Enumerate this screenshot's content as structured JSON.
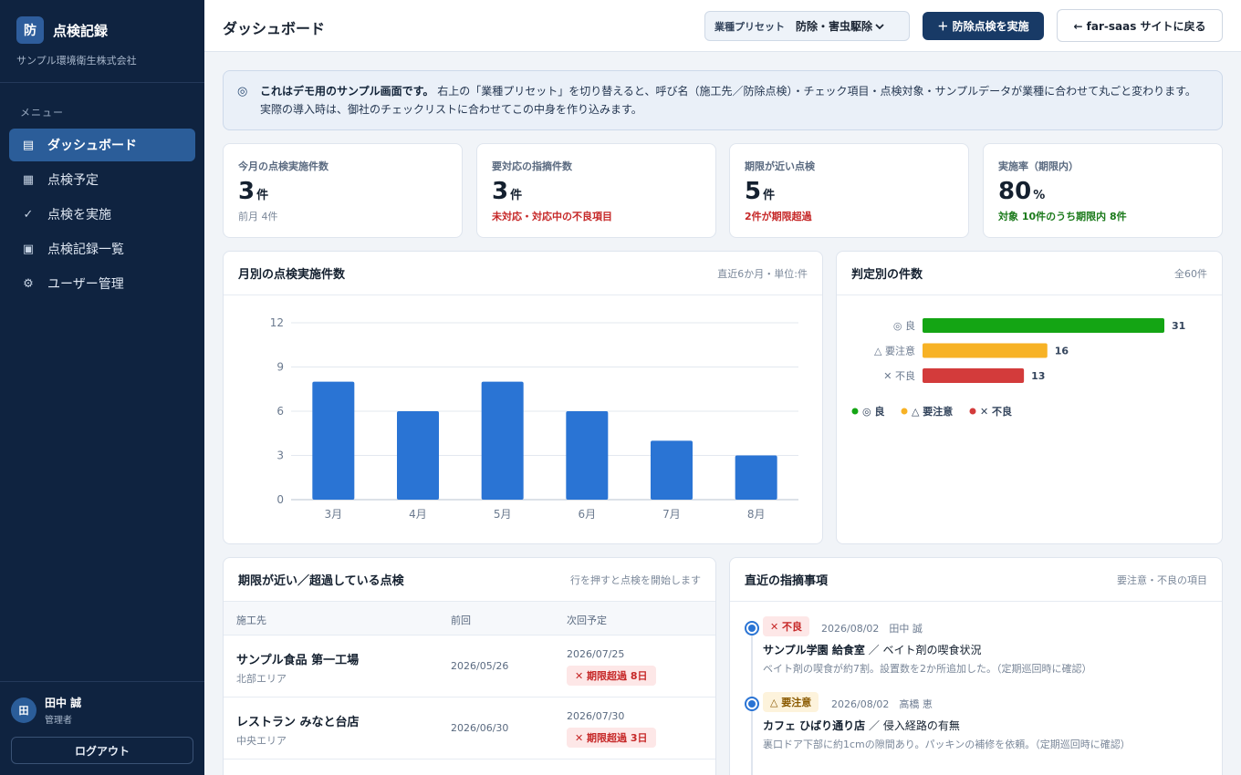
{
  "sidebar": {
    "brand_mark": "防",
    "brand_name": "点検記録",
    "company": "サンプル環境衛生株式会社",
    "menu_title": "メニュー",
    "items": [
      {
        "label": "ダッシュボード",
        "icon": "▤"
      },
      {
        "label": "点検予定",
        "icon": "▦"
      },
      {
        "label": "点検を実施",
        "icon": "✓"
      },
      {
        "label": "点検記録一覧",
        "icon": "▣"
      },
      {
        "label": "ユーザー管理",
        "icon": "⚙"
      }
    ],
    "user": {
      "initial": "田",
      "name": "田中 誠",
      "role": "管理者"
    },
    "logout_label": "ログアウト"
  },
  "header": {
    "title": "ダッシュボード",
    "preset_label": "業種プリセット",
    "preset_value": "防除・害虫駆除",
    "primary_button": "＋ 防除点検を実施",
    "back_button": "← far-saas サイトに戻る"
  },
  "notice": {
    "icon": "◎",
    "strong": "これはデモ用のサンプル画面です。",
    "text": "右上の「業種プリセット」を切り替えると、呼び名（施工先／防除点検）・チェック項目・点検対象・サンプルデータが業種に合わせて丸ごと変わります。実際の導入時は、御社のチェックリストに合わせてこの中身を作り込みます。"
  },
  "stats": [
    {
      "label": "今月の点検実施件数",
      "value": "3",
      "unit": "件",
      "note": "前月 4件"
    },
    {
      "label": "要対応の指摘件数",
      "value": "3",
      "unit": "件",
      "note": "未対応・対応中の不良項目"
    },
    {
      "label": "期限が近い点検",
      "value": "5",
      "unit": "件",
      "note": "2件が期限超過"
    },
    {
      "label": "実施率（期限内）",
      "value": "80",
      "unit": "%",
      "note": "対象 10件のうち期限内 8件"
    }
  ],
  "monthly_panel": {
    "title": "月別の点検実施件数",
    "meta": "直近6か月・単位:件"
  },
  "judgement_panel": {
    "title": "判定別の件数",
    "meta": "全60件"
  },
  "chart_data": [
    {
      "type": "bar",
      "categories": [
        "3月",
        "4月",
        "5月",
        "6月",
        "7月",
        "8月"
      ],
      "values": [
        8,
        6,
        8,
        6,
        4,
        3
      ],
      "ylim": [
        0,
        12
      ],
      "yticks": [
        0,
        3,
        6,
        9,
        12
      ],
      "grid": true,
      "colors": {
        "bar": "#2a74d4"
      }
    },
    {
      "type": "bar",
      "orientation": "horizontal",
      "categories": [
        "◎ 良",
        "△ 要注意",
        "✕ 不良"
      ],
      "values": [
        31,
        16,
        13
      ],
      "xlim": [
        0,
        31
      ],
      "colors": [
        "#14a514",
        "#f7b225",
        "#d33b3b"
      ],
      "legend": [
        "◎ 良",
        "△ 要注意",
        "✕ 不良"
      ],
      "legend_position": "bottom-left"
    }
  ],
  "deadline_panel": {
    "title": "期限が近い／超過している点検",
    "meta": "行を押すと点検を開始します",
    "columns": [
      "施工先",
      "前回",
      "次回予定"
    ],
    "rows": [
      {
        "site": "サンプル食品 第一工場",
        "area": "北部エリア",
        "prev": "2026/05/26",
        "next": "2026/07/25",
        "status": "✕ 期限超過 8日"
      },
      {
        "site": "レストラン みなと台店",
        "area": "中央エリア",
        "prev": "2026/06/30",
        "next": "2026/07/30",
        "status": "✕ 期限超過 3日"
      }
    ]
  },
  "findings_panel": {
    "title": "直近の指摘事項",
    "meta": "要注意・不良の項目",
    "items": [
      {
        "tag": "✕ 不良",
        "level": "ng",
        "date": "2026/08/02",
        "person": "田中 誠",
        "site": "サンプル学園 給食室",
        "item": "ベイト剤の喫食状況",
        "body": "ベイト剤の喫食が約7割。設置数を2か所追加した。（定期巡回時に確認）"
      },
      {
        "tag": "△ 要注意",
        "level": "warn",
        "date": "2026/08/02",
        "person": "高橋 恵",
        "site": "カフェ ひばり通り店",
        "item": "侵入経路の有無",
        "body": "裏口ドア下部に約1cmの隙間あり。パッキンの補修を依頼。（定期巡回時に確認）"
      }
    ]
  }
}
